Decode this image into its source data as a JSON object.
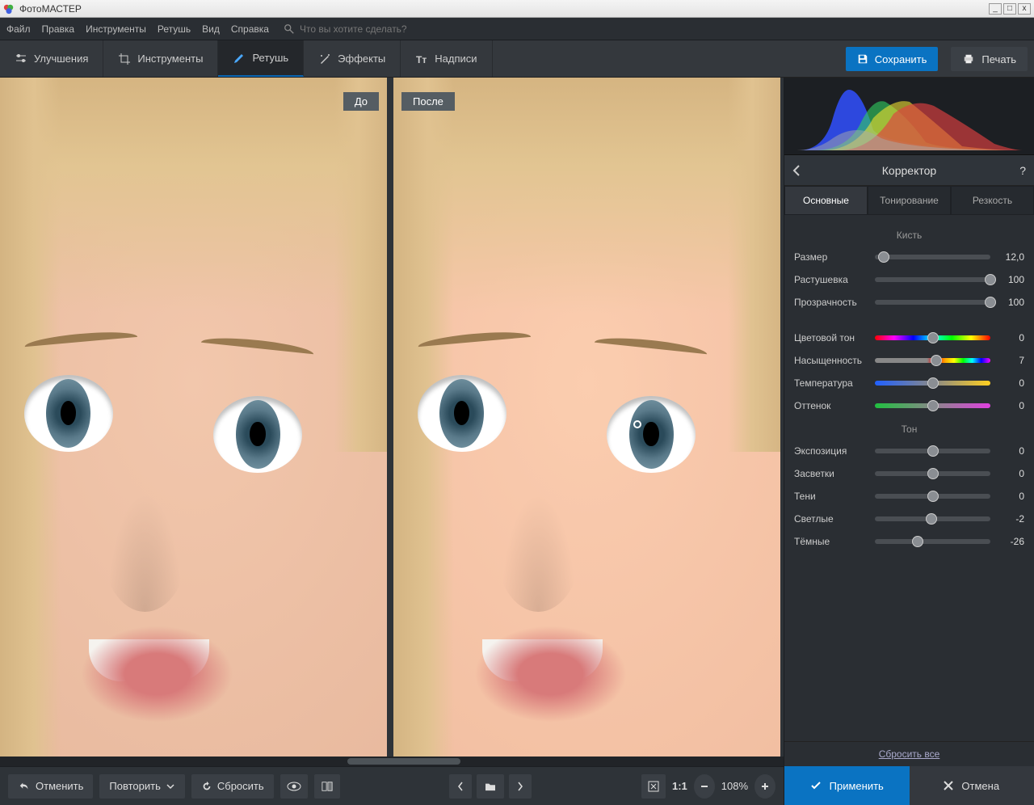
{
  "window": {
    "title": "ФотоМАСТЕР"
  },
  "menu": [
    "Файл",
    "Правка",
    "Инструменты",
    "Ретушь",
    "Вид",
    "Справка"
  ],
  "search_placeholder": "Что вы хотите сделать?",
  "toolbar": {
    "tabs": [
      {
        "id": "enhance",
        "label": "Улучшения"
      },
      {
        "id": "tools",
        "label": "Инструменты"
      },
      {
        "id": "retouch",
        "label": "Ретушь",
        "active": true
      },
      {
        "id": "effects",
        "label": "Эффекты"
      },
      {
        "id": "text",
        "label": "Надписи"
      }
    ],
    "save_label": "Сохранить",
    "print_label": "Печать"
  },
  "view": {
    "before_label": "До",
    "after_label": "После"
  },
  "panel": {
    "title": "Корректор",
    "tabs": [
      {
        "id": "basic",
        "label": "Основные",
        "active": true
      },
      {
        "id": "toning",
        "label": "Тонирование"
      },
      {
        "id": "sharp",
        "label": "Резкость"
      }
    ],
    "brush_section": "Кисть",
    "brush": [
      {
        "id": "size",
        "label": "Размер",
        "value": "12,0",
        "pos": 8
      },
      {
        "id": "feather",
        "label": "Растушевка",
        "value": "100",
        "pos": 100
      },
      {
        "id": "opacity",
        "label": "Прозрачность",
        "value": "100",
        "pos": 100
      }
    ],
    "color": [
      {
        "id": "hue",
        "label": "Цветовой тон",
        "value": "0",
        "pos": 50,
        "grad": "g-hue"
      },
      {
        "id": "sat",
        "label": "Насыщенность",
        "value": "7",
        "pos": 53,
        "grad": "g-sat"
      },
      {
        "id": "temp",
        "label": "Температура",
        "value": "0",
        "pos": 50,
        "grad": "g-temp"
      },
      {
        "id": "tint",
        "label": "Оттенок",
        "value": "0",
        "pos": 50,
        "grad": "g-tint"
      }
    ],
    "tone_section": "Тон",
    "tone": [
      {
        "id": "exp",
        "label": "Экспозиция",
        "value": "0",
        "pos": 50
      },
      {
        "id": "high",
        "label": "Засветки",
        "value": "0",
        "pos": 50
      },
      {
        "id": "shad",
        "label": "Тени",
        "value": "0",
        "pos": 50
      },
      {
        "id": "white",
        "label": "Светлые",
        "value": "-2",
        "pos": 49
      },
      {
        "id": "black",
        "label": "Тёмные",
        "value": "-26",
        "pos": 37
      }
    ],
    "reset_all": "Сбросить все",
    "apply": "Применить",
    "cancel": "Отмена"
  },
  "status": {
    "undo": "Отменить",
    "redo": "Повторить",
    "reset": "Сбросить",
    "zoom": "108%"
  }
}
